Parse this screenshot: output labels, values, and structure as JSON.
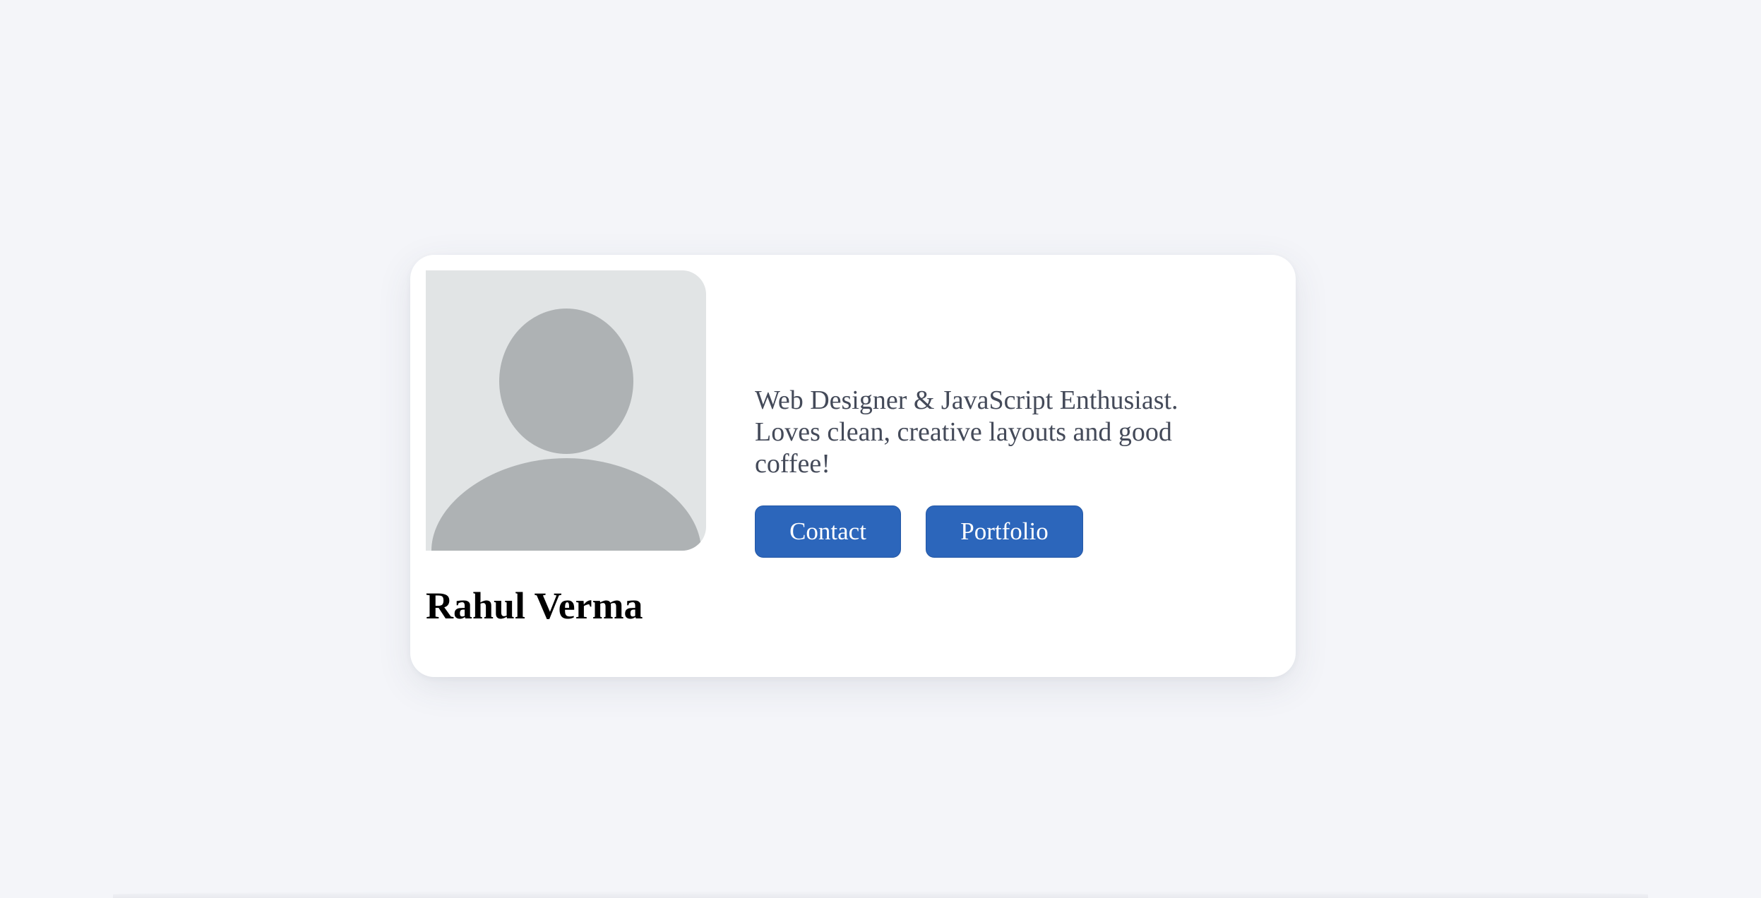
{
  "profile": {
    "name": "Rahul Verma",
    "bio": "Web Designer & JavaScript Enthusiast. Loves clean, creative layouts and good coffee!",
    "avatar_icon": "user-silhouette-icon"
  },
  "actions": {
    "contact_label": "Contact",
    "portfolio_label": "Portfolio"
  },
  "colors": {
    "page_background": "#f4f5f9",
    "card_background": "#ffffff",
    "button_background": "#2c66bb",
    "bio_text": "#444a59",
    "avatar_background": "#e1e4e5",
    "avatar_silhouette": "#aeb2b4"
  }
}
